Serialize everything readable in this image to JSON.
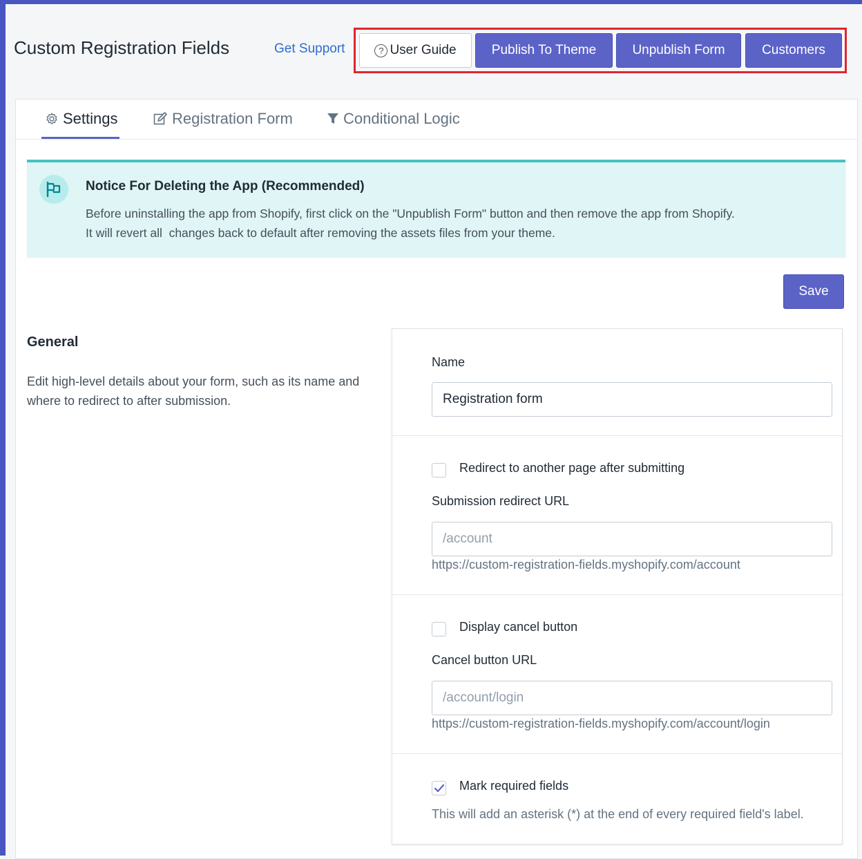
{
  "header": {
    "app_title": "Custom Registration Fields",
    "support_link": "Get Support",
    "buttons": {
      "user_guide": "User Guide",
      "publish": "Publish To Theme",
      "unpublish": "Unpublish Form",
      "customers": "Customers"
    }
  },
  "tabs": [
    {
      "label": "Settings",
      "icon": "gear-icon",
      "active": true
    },
    {
      "label": "Registration Form",
      "icon": "edit-icon",
      "active": false
    },
    {
      "label": "Conditional Logic",
      "icon": "filter-icon",
      "active": false
    }
  ],
  "notice": {
    "title": "Notice For Deleting the App (Recommended)",
    "line1": "Before uninstalling the app from Shopify, first click on the \"Unpublish Form\" button and then remove the app from Shopify.",
    "line2": "It will revert all  changes back to default after removing the assets files from your theme.",
    "icon": "flag-icon"
  },
  "save_label": "Save",
  "general": {
    "title": "General",
    "description": "Edit high-level details about your form, such as its name and where to redirect to after submission."
  },
  "form": {
    "name_label": "Name",
    "name_value": "Registration form",
    "redirect_checkbox_label": "Redirect to another page after submitting",
    "redirect_checked": false,
    "redirect_url_label": "Submission redirect URL",
    "redirect_url_placeholder": "/account",
    "redirect_url_help": "https://custom-registration-fields.myshopify.com/account",
    "cancel_checkbox_label": "Display cancel button",
    "cancel_checked": false,
    "cancel_url_label": "Cancel button URL",
    "cancel_url_placeholder": "/account/login",
    "cancel_url_help": "https://custom-registration-fields.myshopify.com/account/login",
    "required_checkbox_label": "Mark required fields",
    "required_checked": true,
    "required_help": "This will add an asterisk (*) at the end of every required field's label."
  },
  "colors": {
    "primary": "#5c63c7",
    "highlight_border": "#e2242d",
    "notice_bg": "#e0f5f5",
    "notice_accent": "#47c1bf",
    "link": "#2c6ecb"
  }
}
